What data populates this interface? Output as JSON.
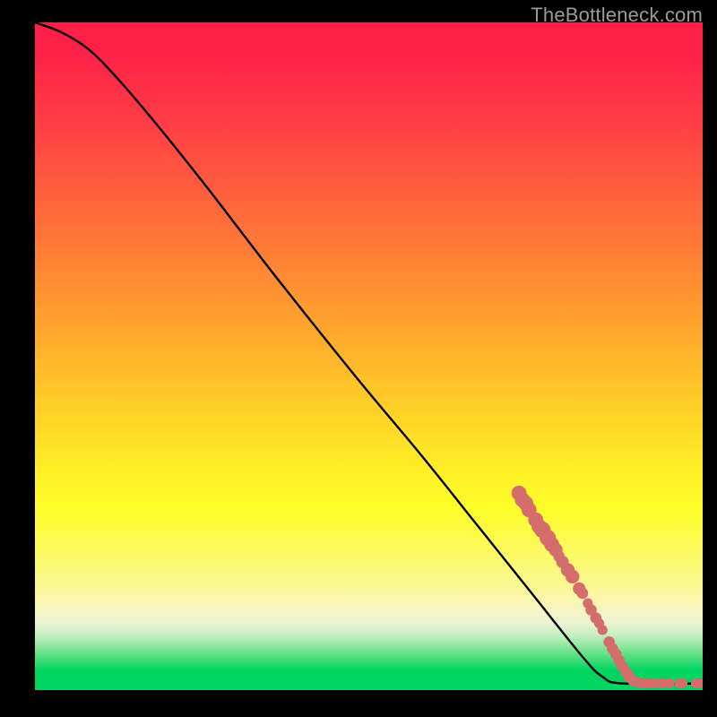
{
  "watermark": "TheBottleneck.com",
  "chart_data": {
    "type": "line",
    "title": "",
    "xlabel": "",
    "ylabel": "",
    "xlim": [
      0,
      100
    ],
    "ylim": [
      0,
      100
    ],
    "grid": false,
    "legend": false,
    "series": [
      {
        "name": "bottleneck-curve",
        "points": [
          {
            "x": 0,
            "y": 100
          },
          {
            "x": 4,
            "y": 98.5
          },
          {
            "x": 8,
            "y": 96
          },
          {
            "x": 12,
            "y": 92
          },
          {
            "x": 18,
            "y": 85
          },
          {
            "x": 26,
            "y": 75
          },
          {
            "x": 36,
            "y": 62
          },
          {
            "x": 48,
            "y": 47
          },
          {
            "x": 58,
            "y": 35
          },
          {
            "x": 66,
            "y": 25
          },
          {
            "x": 74,
            "y": 15
          },
          {
            "x": 82,
            "y": 5
          },
          {
            "x": 85,
            "y": 2
          },
          {
            "x": 88,
            "y": 1
          },
          {
            "x": 100,
            "y": 1
          }
        ]
      },
      {
        "name": "highlight-markers",
        "points": [
          {
            "x": 72.5,
            "y": 29.5,
            "r": 1.2
          },
          {
            "x": 73.0,
            "y": 28.5,
            "r": 1.2
          },
          {
            "x": 73.5,
            "y": 28.0,
            "r": 1.2
          },
          {
            "x": 74.0,
            "y": 27.0,
            "r": 1.2
          },
          {
            "x": 75.0,
            "y": 25.5,
            "r": 1.2
          },
          {
            "x": 75.5,
            "y": 24.5,
            "r": 1.2
          },
          {
            "x": 76.0,
            "y": 24.0,
            "r": 1.3
          },
          {
            "x": 76.8,
            "y": 22.8,
            "r": 1.3
          },
          {
            "x": 77.4,
            "y": 21.8,
            "r": 1.2
          },
          {
            "x": 78.0,
            "y": 21.0,
            "r": 1.1
          },
          {
            "x": 78.5,
            "y": 20.0,
            "r": 0.9
          },
          {
            "x": 79.0,
            "y": 19.2,
            "r": 1.0
          },
          {
            "x": 79.8,
            "y": 18.0,
            "r": 1.1
          },
          {
            "x": 80.5,
            "y": 17.0,
            "r": 1.1
          },
          {
            "x": 81.5,
            "y": 15.2,
            "r": 1.0
          },
          {
            "x": 82.0,
            "y": 14.5,
            "r": 0.9
          },
          {
            "x": 82.8,
            "y": 13.0,
            "r": 0.8
          },
          {
            "x": 83.3,
            "y": 12.0,
            "r": 0.9
          },
          {
            "x": 84.0,
            "y": 10.8,
            "r": 0.9
          },
          {
            "x": 84.5,
            "y": 10.0,
            "r": 0.8
          },
          {
            "x": 85.0,
            "y": 9.0,
            "r": 0.8
          },
          {
            "x": 86.0,
            "y": 7.2,
            "r": 0.9
          },
          {
            "x": 86.5,
            "y": 6.2,
            "r": 0.9
          },
          {
            "x": 87.0,
            "y": 5.4,
            "r": 0.9
          },
          {
            "x": 87.5,
            "y": 4.4,
            "r": 0.9
          },
          {
            "x": 88.0,
            "y": 3.5,
            "r": 0.9
          },
          {
            "x": 88.6,
            "y": 2.6,
            "r": 0.9
          },
          {
            "x": 89.0,
            "y": 2.0,
            "r": 0.9
          },
          {
            "x": 89.6,
            "y": 1.4,
            "r": 0.9
          },
          {
            "x": 90.0,
            "y": 1.2,
            "r": 0.8
          },
          {
            "x": 90.5,
            "y": 1.1,
            "r": 0.8
          },
          {
            "x": 91.0,
            "y": 1.0,
            "r": 0.8
          },
          {
            "x": 91.6,
            "y": 1.0,
            "r": 0.8
          },
          {
            "x": 92.0,
            "y": 1.0,
            "r": 0.8
          },
          {
            "x": 93.0,
            "y": 1.0,
            "r": 0.8
          },
          {
            "x": 94.0,
            "y": 1.0,
            "r": 0.8
          },
          {
            "x": 95.0,
            "y": 1.0,
            "r": 0.8
          },
          {
            "x": 96.5,
            "y": 1.0,
            "r": 0.8
          },
          {
            "x": 97.0,
            "y": 1.0,
            "r": 0.8
          },
          {
            "x": 99.0,
            "y": 1.0,
            "r": 0.8
          },
          {
            "x": 99.5,
            "y": 1.0,
            "r": 0.8
          }
        ]
      }
    ],
    "colors": {
      "curve": "#000000",
      "markers": "#d66d6d",
      "gradient_stops": [
        {
          "pos": 0.0,
          "color": "#ff2048"
        },
        {
          "pos": 0.3,
          "color": "#ff6e3a"
        },
        {
          "pos": 0.58,
          "color": "#ffd027"
        },
        {
          "pos": 0.73,
          "color": "#fdfd2a"
        },
        {
          "pos": 0.97,
          "color": "#00d562"
        }
      ]
    }
  }
}
